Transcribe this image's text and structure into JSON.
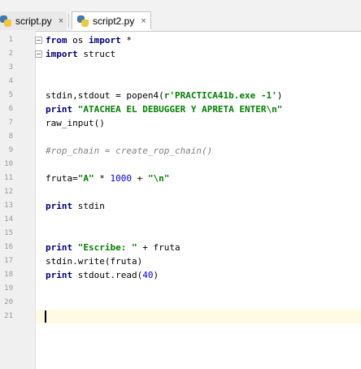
{
  "tabs": [
    {
      "label": "script.py",
      "active": false
    },
    {
      "label": "script2.py",
      "active": true
    }
  ],
  "close_glyph": "×",
  "line_numbers": [
    "1",
    "2",
    "3",
    "4",
    "5",
    "6",
    "7",
    "8",
    "9",
    "10",
    "11",
    "12",
    "13",
    "14",
    "15",
    "16",
    "17",
    "18",
    "19",
    "20",
    "21"
  ],
  "code": {
    "l1": {
      "kw": "from",
      "mid": " os ",
      "kw2": "import",
      "rest": " *"
    },
    "l2": {
      "kw": "import",
      "rest": " struct"
    },
    "l5": {
      "a": "stdin,stdout = popen4(",
      "str": "r'PRACTICA41b.exe -1'",
      "b": ")"
    },
    "l6": {
      "kw": "print",
      "sp": " ",
      "str": "\"ATACHEA EL DEBUGGER Y APRETA ENTER\\n\""
    },
    "l7": {
      "text": "raw_input()"
    },
    "l9": {
      "comment": "#rop_chain = create_rop_chain()"
    },
    "l11": {
      "a": "fruta=",
      "str": "\"A\"",
      "b": " * ",
      "num": "1000",
      "c": " + ",
      "str2": "\"\\n\""
    },
    "l13": {
      "kw": "print",
      "rest": " stdin"
    },
    "l16": {
      "kw": "print",
      "sp": " ",
      "str": "\"Escribe: \"",
      "rest": " + fruta"
    },
    "l17": {
      "text": "stdin.write(fruta)"
    },
    "l18": {
      "kw": "print",
      "a": " stdout.read(",
      "num": "40",
      "b": ")"
    }
  },
  "colors": {
    "keyword": "#000080",
    "string": "#008000",
    "number": "#0000ff",
    "comment": "#808080",
    "caret_line": "#fffae3"
  }
}
